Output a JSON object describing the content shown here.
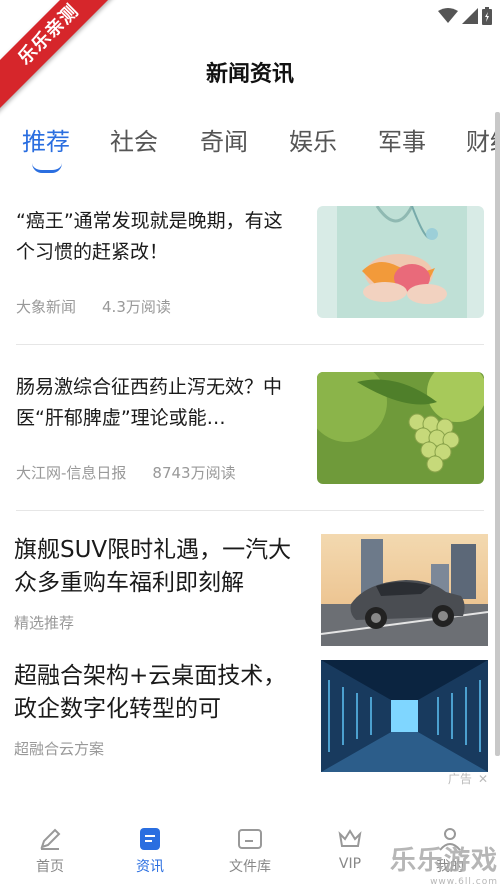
{
  "ribbon": {
    "text": "乐乐亲测"
  },
  "header": {
    "title": "新闻资讯"
  },
  "tabs": [
    {
      "label": "推荐",
      "active": true
    },
    {
      "label": "社会"
    },
    {
      "label": "奇闻"
    },
    {
      "label": "娱乐"
    },
    {
      "label": "军事"
    },
    {
      "label": "财经"
    }
  ],
  "articles": [
    {
      "title": "“癌王”通常发现就是晚期，有这个习惯的赶紧改！",
      "source": "大象新闻",
      "reads": "4.3万阅读",
      "image": "medical-organ-image"
    },
    {
      "title": "肠易激综合征西药止泻无效？中医“肝郁脾虚”理论或能…",
      "source": "大江网-信息日报",
      "reads": "8743万阅读",
      "image": "grapes-image"
    }
  ],
  "ads": [
    {
      "title": "旗舰SUV限时礼遇，一汽大众多重购车福利即刻解",
      "source": "精选推荐",
      "image": "suv-car-image"
    },
    {
      "title": "超融合架构+云桌面技术，政企数字化转型的可",
      "source": "超融合云方案",
      "image": "server-room-image"
    }
  ],
  "ad_tag": {
    "label": "广告"
  },
  "bottom_nav": [
    {
      "label": "首页",
      "icon": "pen-icon"
    },
    {
      "label": "资讯",
      "icon": "news-icon",
      "active": true
    },
    {
      "label": "文件库",
      "icon": "folder-icon"
    },
    {
      "label": "VIP",
      "icon": "crown-icon"
    },
    {
      "label": "我的",
      "icon": "user-icon"
    }
  ],
  "watermark": {
    "brand": "乐乐游戏",
    "url": "www.6ll.com"
  },
  "colors": {
    "accent": "#2a6ee0",
    "ribbon": "#d6262b",
    "meta": "#999999"
  }
}
